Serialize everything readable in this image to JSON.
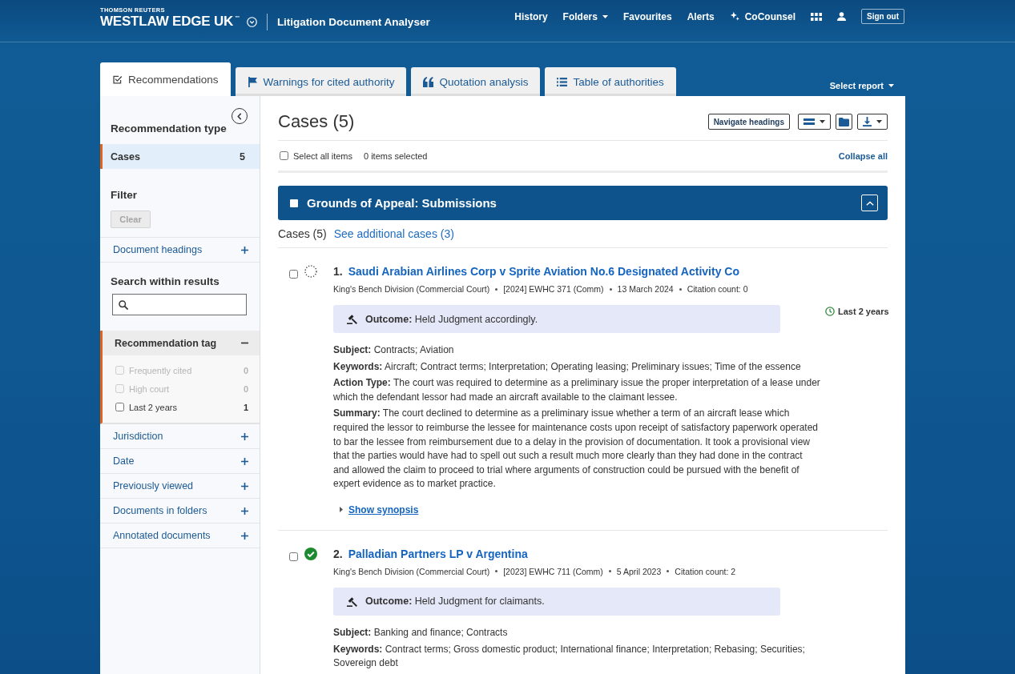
{
  "header": {
    "company": "THOMSON REUTERS",
    "brand": "WESTLAW EDGE UK$^{™}$",
    "product": "Litigation Document Analyser",
    "nav": [
      {
        "label": "History",
        "kind": "link"
      },
      {
        "label": "Folders",
        "kind": "dropdown"
      },
      {
        "label": "Favourites",
        "kind": "link"
      },
      {
        "label": "Alerts",
        "kind": "link"
      },
      {
        "label": "CoCounsel",
        "kind": "assistant"
      }
    ],
    "sign_out": "Sign out"
  },
  "tabs": [
    {
      "label": "Recommendations",
      "selected": true
    },
    {
      "label": "Warnings for cited authority",
      "selected": false
    },
    {
      "label": "Quotation analysis",
      "selected": false
    },
    {
      "label": "Table of authorities",
      "selected": false
    }
  ],
  "report_menu": "Select report",
  "sidebar": {
    "type_heading": "Recommendation type",
    "types": [
      {
        "label": "Cases",
        "count": "5",
        "selected": true
      }
    ],
    "filter_heading": "Filter",
    "clear_button": {
      "label": "Clear",
      "disabled": true
    },
    "heading_filters": [
      {
        "label": "Document headings",
        "expanded": false
      }
    ],
    "search_heading": "Search within results",
    "facets": [
      {
        "label": "Recommendation tag",
        "expanded": true,
        "options": [
          {
            "label": "Frequently cited",
            "count": "0",
            "checked": false,
            "disabled": true
          },
          {
            "label": "High court",
            "count": "0",
            "checked": false,
            "disabled": true
          },
          {
            "label": "Last 2 years",
            "count": "1",
            "checked": false,
            "disabled": false
          }
        ]
      },
      {
        "label": "Jurisdiction",
        "expanded": false
      },
      {
        "label": "Date",
        "expanded": false
      },
      {
        "label": "Previously viewed",
        "expanded": false
      },
      {
        "label": "Documents in folders",
        "expanded": false
      },
      {
        "label": "Annotated documents",
        "expanded": false
      }
    ]
  },
  "results": {
    "title": "Cases (5)",
    "navigate_button": "Navigate headings",
    "select_all": {
      "label": "Select all items",
      "checked": false
    },
    "selected_count": "0 items selected",
    "collapse_all": "Collapse all",
    "groups": [
      {
        "title": "Grounds of Appeal: Submissions",
        "checked": false,
        "expanded": true,
        "count": "Cases (5)",
        "more_link": "See additional cases (3)",
        "cases": [
          {
            "number": "1.",
            "title": "Saudi Arabian Airlines Corp v Sprite Aviation No.6 Designated Activity Co",
            "checked": false,
            "kind": "pending",
            "meta": [
              "King's Bench Division (Commercial Court)",
              "[2024] EWHC 371 (Comm)",
              "13 March 2024",
              "Citation count: 0"
            ],
            "outcome": "**Outcome:** Held Judgment accordingly.",
            "tags": [
              {
                "label": "Last 2 years"
              }
            ],
            "fields": [
              "**Subject:** Contracts; Aviation",
              "**Keywords:** Aircraft; Contract terms; Interpretation; Operating leasing; Preliminary issues; Time of the essence",
              "**Action Type:** The court was required to determine as a preliminary issue the proper interpretation of a lease under which the defendant lessor had made an aircraft available to the claimant lessee.",
              "**Summary:** The court declined to determine as a preliminary issue whether a term of an aircraft lease which required the lessor to reimburse the lessee for maintenance costs upon receipt of satisfactory paperwork operated to bar the lessee from reimbursement due to a delay in the provision of documentation. It took a provisional view that the parties would have had to spell out such a result much more clearly than they had done in the contract and allowed the claim to proceed to trial where arguments of construction could be pursued with the benefit of expert evidence as to market practice."
            ],
            "synopsis_link": "Show synopsis"
          },
          {
            "number": "2.",
            "title": "Palladian Partners LP v Argentina",
            "checked": false,
            "kind": "confirmed",
            "meta": [
              "King's Bench Division (Commercial Court)",
              "[2023] EWHC 711 (Comm)",
              "5 April 2023",
              "Citation count: 2"
            ],
            "outcome": "**Outcome:** Held Judgment for claimants.",
            "fields": [
              "**Subject:** Banking and finance; Contracts",
              "**Keywords:** Contract terms; Gross domestic product; International finance; Interpretation; Rebasing; Securities; Sovereign debt"
            ]
          }
        ]
      }
    ]
  }
}
